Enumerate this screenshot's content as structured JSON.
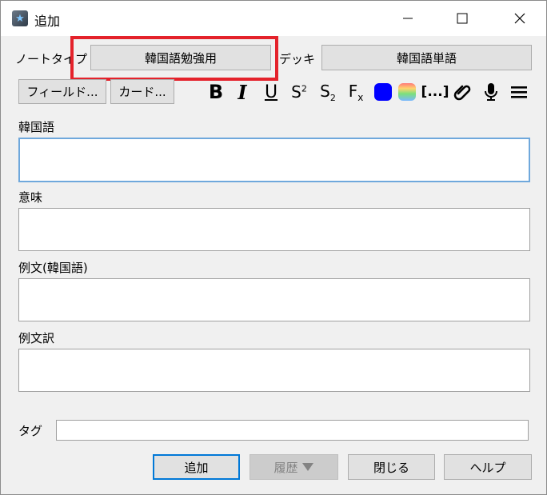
{
  "window": {
    "title": "追加"
  },
  "toolbar": {
    "notetype_label": "ノートタイプ",
    "notetype_value": "韓国語勉強用",
    "deck_label": "デッキ",
    "deck_value": "韓国語単語",
    "fields_button": "フィールド...",
    "cards_button": "カード...",
    "format": {
      "bold": "B",
      "italic": "I",
      "underline": "U",
      "superscript": "S",
      "superscript_mark": "2",
      "subscript": "S",
      "subscript_mark": "2",
      "clear_format": "F",
      "clear_format_mark": "x",
      "cloze": "[...]",
      "text_color": "#0000ff"
    }
  },
  "fields": [
    {
      "label": "韓国語",
      "value": ""
    },
    {
      "label": "意味",
      "value": ""
    },
    {
      "label": "例文(韓国語)",
      "value": ""
    },
    {
      "label": "例文訳",
      "value": ""
    }
  ],
  "tags": {
    "label": "タグ",
    "value": ""
  },
  "buttons": {
    "add": "追加",
    "history": "履歴",
    "close": "閉じる",
    "help": "ヘルプ"
  },
  "colors": {
    "highlight": "#e4222b",
    "focus": "#6fa8dc"
  }
}
